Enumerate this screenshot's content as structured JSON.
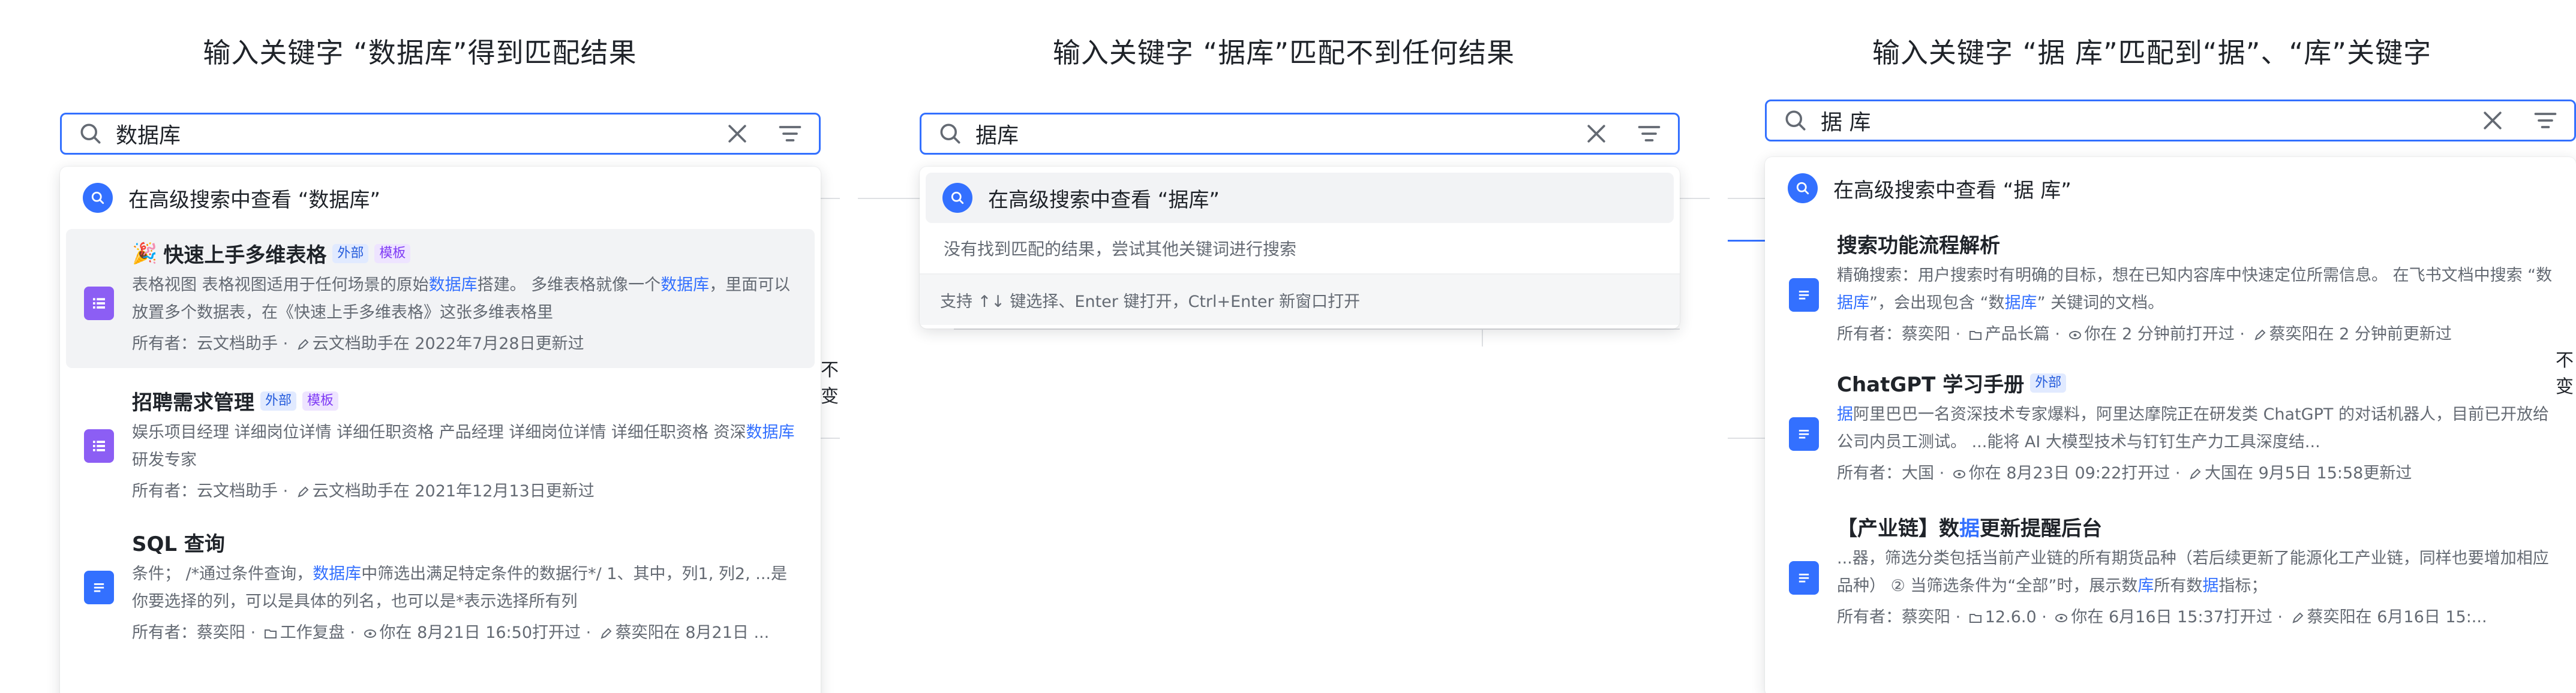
{
  "panels": [
    {
      "caption": "输入关键字 “数据库”得到匹配结果",
      "search_value": "数据库",
      "advanced_label": "在高级搜索中查看 “数据库”",
      "results": [
        {
          "title": "快速上手多维表格",
          "title_emoji": "🎉",
          "tags": [
            "外部",
            "模板"
          ],
          "snippet_parts": [
            "表格视图 表格视图适用于任何场景的原始",
            "数据库",
            "搭建。 多维表格就像一个",
            "数据库",
            "，里面可以放置多个数据表，在《快速上手多维表格》这张多维表格里"
          ],
          "owner": "所有者：云文档助手",
          "updated": "云文档助手在 2022年7月28日更新过"
        },
        {
          "title": "招聘需求管理",
          "tags": [
            "外部",
            "模板"
          ],
          "snippet_parts": [
            "娱乐项目经理 详细岗位详情 详细任职资格 产品经理 详细岗位详情 详细任职资格 资深",
            "数据库",
            "研发专家"
          ],
          "owner": "所有者：云文档助手",
          "updated": "云文档助手在 2021年12月13日更新过"
        },
        {
          "title": "SQL 查询",
          "tags": [],
          "snippet_parts": [
            "条件； /*通过条件查询，",
            "数据库",
            "中筛选出满足特定条件的数据行*/ 1、其中，列1, 列2, ...是你要选择的列，可以是具体的列名，也可以是*表示选择所有列"
          ],
          "owner": "所有者：蔡奕阳",
          "folder": "工作复盘",
          "opened": "你在 8月21日 16:50打开过",
          "updated": "蔡奕阳在 8月21日 ..."
        }
      ],
      "bg_fragment": "不变"
    },
    {
      "caption": "输入关键字 “据库”匹配不到任何结果",
      "search_value": "据库",
      "advanced_label": "在高级搜索中查看 “据库”",
      "no_result_text": "没有找到匹配的结果，尝试其他关键词进行搜索",
      "hint_text": "支持 ↑↓ 键选择、Enter 键打开，Ctrl+Enter 新窗口打开"
    },
    {
      "caption": "输入关键字 “据 库”匹配到“据”、“库”关键字",
      "search_value": "据 库",
      "advanced_label": "在高级搜索中查看 “据 库”",
      "results": [
        {
          "title": "搜索功能流程解析",
          "tags": [],
          "snippet_parts": [
            "精确搜索：用户搜索时有明确的目标，想在已知内容库中快速定位所需信息。 在飞书文档中搜索 “数",
            "据库",
            "”，会出现包含 “数",
            "据库",
            "” 关键词的文档。"
          ],
          "owner": "所有者：蔡奕阳",
          "folder": "产品长篇",
          "opened": "你在 2 分钟前打开过",
          "updated": "蔡奕阳在 2 分钟前更新过"
        },
        {
          "title": "ChatGPT 学习手册",
          "tags": [
            "外部"
          ],
          "snippet_parts": [
            "",
            "据",
            "阿里巴巴一名资深技术专家爆料，阿里达摩院正在研发类 ChatGPT 的对话机器人，目前已开放给公司内员工测试。 ...能将 AI 大模型技术与钉钉生产力工具深度结..."
          ],
          "owner": "所有者：大国",
          "opened": "你在 8月23日 09:22打开过",
          "updated": "大国在 9月5日 15:58更新过"
        },
        {
          "title_parts": [
            "【产业链】数",
            "据",
            "更新提醒后台"
          ],
          "tags": [],
          "snippet_parts": [
            "...器，筛选分类包括当前产业链的所有期货品种（若后续更新了能源化工产业链，同样也要增加相应品种） ② 当筛选条件为“全部”时，展示数",
            "库",
            "所有数",
            "据",
            "指标；"
          ],
          "owner": "所有者：蔡奕阳",
          "folder": "12.6.0",
          "opened": "你在 6月16日 15:37打开过",
          "updated": "蔡奕阳在 6月16日 15:..."
        }
      ],
      "bg_fragment": "不变"
    }
  ]
}
